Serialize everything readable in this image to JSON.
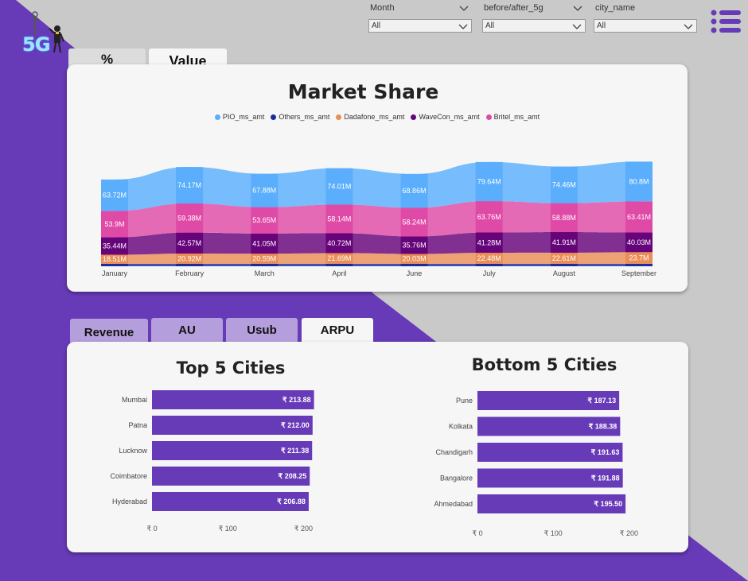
{
  "filters": [
    {
      "label": "Month",
      "value": "All"
    },
    {
      "label": "before/after_5g",
      "value": "All"
    },
    {
      "label": "city_name",
      "value": "All"
    }
  ],
  "logo": {
    "text": "5G"
  },
  "top_tabs": [
    {
      "label": "%",
      "active": false
    },
    {
      "label": "Value",
      "active": true
    }
  ],
  "market_share": {
    "title": "Market Share"
  },
  "metric_tabs": [
    {
      "label": "Revenue",
      "active": false
    },
    {
      "label": "AU",
      "active": false
    },
    {
      "label": "Usub",
      "active": false
    },
    {
      "label": "ARPU",
      "active": true
    }
  ],
  "top_cities": {
    "title": "Top 5 Cities"
  },
  "bottom_cities": {
    "title": "Bottom 5 Cities"
  },
  "colors": {
    "purple": "#673ab7",
    "PIO_ms_amt": "#5aaefc",
    "Others_ms_amt": "#1a2d9e",
    "Dadafone_ms_amt": "#ea8d57",
    "WaveCon_ms_amt": "#66047a",
    "Britel_ms_amt": "#e04aa7",
    "bar": "#673ab7"
  },
  "chart_data": [
    {
      "type": "area",
      "chart": "market_share",
      "title": "Market Share",
      "categories": [
        "January",
        "February",
        "March",
        "April",
        "June",
        "July",
        "August",
        "September"
      ],
      "series": [
        {
          "name": "PIO_ms_amt",
          "values": [
            63.72,
            74.17,
            67.88,
            74.01,
            68.86,
            79.64,
            74.46,
            80.8
          ],
          "labels": [
            "63.72M",
            "74.17M",
            "67.88M",
            "74.01M",
            "68.86M",
            "79.64M",
            "74.46M",
            "80.8M"
          ]
        },
        {
          "name": "Others_ms_amt",
          "values": [
            5,
            5,
            5,
            5,
            5,
            5,
            5,
            5
          ],
          "labels": []
        },
        {
          "name": "Dadafone_ms_amt",
          "values": [
            18.51,
            20.92,
            20.59,
            21.69,
            20.03,
            22.48,
            22.61,
            23.7
          ],
          "labels": [
            "18.51M",
            "20.92M",
            "20.59M",
            "21.69M",
            "20.03M",
            "22.48M",
            "22.61M",
            "23.7M"
          ]
        },
        {
          "name": "WaveCon_ms_amt",
          "values": [
            35.44,
            42.57,
            41.05,
            40.72,
            35.76,
            41.28,
            41.91,
            40.03
          ],
          "labels": [
            "35.44M",
            "42.57M",
            "41.05M",
            "40.72M",
            "35.76M",
            "41.28M",
            "41.91M",
            "40.03M"
          ]
        },
        {
          "name": "Britel_ms_amt",
          "values": [
            53.9,
            59.38,
            53.65,
            58.14,
            58.24,
            63.76,
            58.88,
            63.41
          ],
          "labels": [
            "53.9M",
            "59.38M",
            "53.65M",
            "58.14M",
            "58.24M",
            "63.76M",
            "58.88M",
            "63.41M"
          ]
        }
      ]
    },
    {
      "type": "bar",
      "chart": "top_cities",
      "title": "Top 5 Cities",
      "orientation": "horizontal",
      "categories": [
        "Mumbai",
        "Patna",
        "Lucknow",
        "Coimbatore",
        "Hyderabad"
      ],
      "values": [
        213.88,
        212.0,
        211.38,
        208.25,
        206.88
      ],
      "labels": [
        "₹ 213.88",
        "₹ 212.00",
        "₹ 211.38",
        "₹ 208.25",
        "₹ 206.88"
      ],
      "xticks": [
        "₹ 0",
        "₹ 100",
        "₹ 200"
      ],
      "xlim": [
        0,
        205
      ]
    },
    {
      "type": "bar",
      "chart": "bottom_cities",
      "title": "Bottom 5 Cities",
      "orientation": "horizontal",
      "categories": [
        "Pune",
        "Kolkata",
        "Chandigarh",
        "Bangalore",
        "Ahmedabad"
      ],
      "values": [
        187.13,
        188.38,
        191.63,
        191.88,
        195.5
      ],
      "labels": [
        "₹ 187.13",
        "₹ 188.38",
        "₹ 191.63",
        "₹ 191.88",
        "₹ 195.50"
      ],
      "xticks": [
        "₹ 0",
        "₹ 100",
        "₹ 200"
      ],
      "xlim": [
        0,
        205
      ]
    }
  ]
}
